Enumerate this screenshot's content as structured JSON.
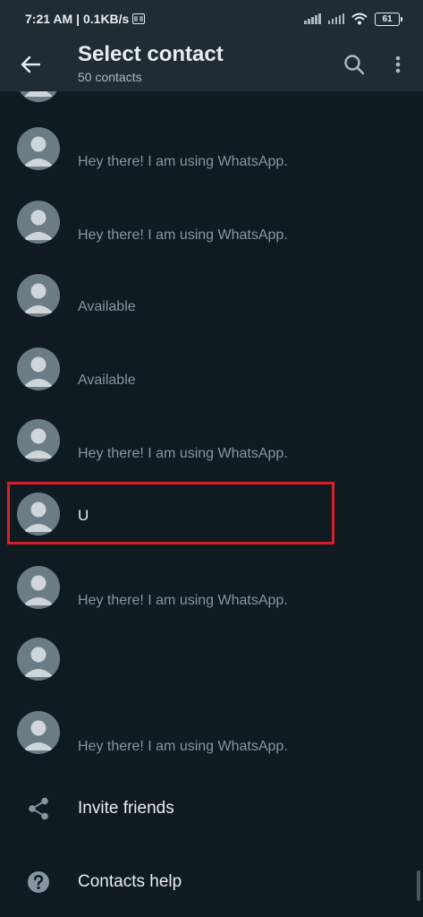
{
  "status": {
    "time": "7:21 AM",
    "network_speed": "| 0.1KB/s",
    "battery": "61"
  },
  "header": {
    "title": "Select contact",
    "subtitle": "50 contacts"
  },
  "contacts": [
    {
      "name": "",
      "status": "Hey there! I am using WhatsApp."
    },
    {
      "name": "",
      "status": "Hey there! I am using WhatsApp."
    },
    {
      "name": "",
      "status": "Available"
    },
    {
      "name": "",
      "status": "Available"
    },
    {
      "name": "",
      "status": "Hey there! I am using WhatsApp."
    },
    {
      "name": "U",
      "status": ""
    },
    {
      "name": "",
      "status": "Hey there! I am using WhatsApp."
    },
    {
      "name": "",
      "status": ""
    },
    {
      "name": "",
      "status": "Hey there! I am using WhatsApp."
    }
  ],
  "actions": {
    "invite": "Invite friends",
    "help": "Contacts help"
  },
  "colors": {
    "background": "#101a21",
    "bar": "#1f2c34",
    "highlight": "#d8202a"
  }
}
